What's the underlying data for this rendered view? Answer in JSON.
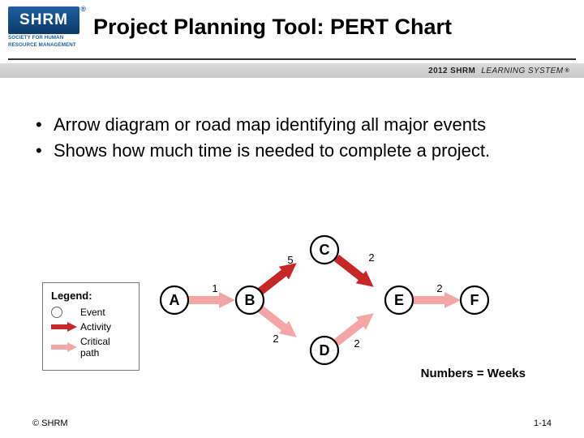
{
  "header": {
    "logo_text": "SHRM",
    "logo_reg": "®",
    "logo_subline1": "SOCIETY FOR HUMAN",
    "logo_subline2": "RESOURCE MANAGEMENT",
    "title": "Project Planning Tool: PERT Chart",
    "subband_year": "2012",
    "subband_brand": "SHRM",
    "subband_tail": "LEARNING SYSTEM",
    "subband_reg": "®"
  },
  "bullets": [
    "Arrow diagram or road map identifying all major events",
    "Shows how much time is needed to complete a project."
  ],
  "legend": {
    "title": "Legend:",
    "event": "Event",
    "activity": "Activity",
    "critical": "Critical path"
  },
  "pert": {
    "nodes": [
      "A",
      "B",
      "C",
      "D",
      "E",
      "F"
    ],
    "edges": [
      {
        "from": "A",
        "to": "B",
        "weeks": 1,
        "critical": true
      },
      {
        "from": "B",
        "to": "C",
        "weeks": 5,
        "critical": false
      },
      {
        "from": "B",
        "to": "D",
        "weeks": 2,
        "critical": true
      },
      {
        "from": "C",
        "to": "E",
        "weeks": 2,
        "critical": false
      },
      {
        "from": "D",
        "to": "E",
        "weeks": 2,
        "critical": true
      },
      {
        "from": "E",
        "to": "F",
        "weeks": 2,
        "critical": true
      }
    ],
    "numbers_label": "Numbers = Weeks"
  },
  "footer": {
    "copyright": "© SHRM",
    "page": "1-14"
  }
}
